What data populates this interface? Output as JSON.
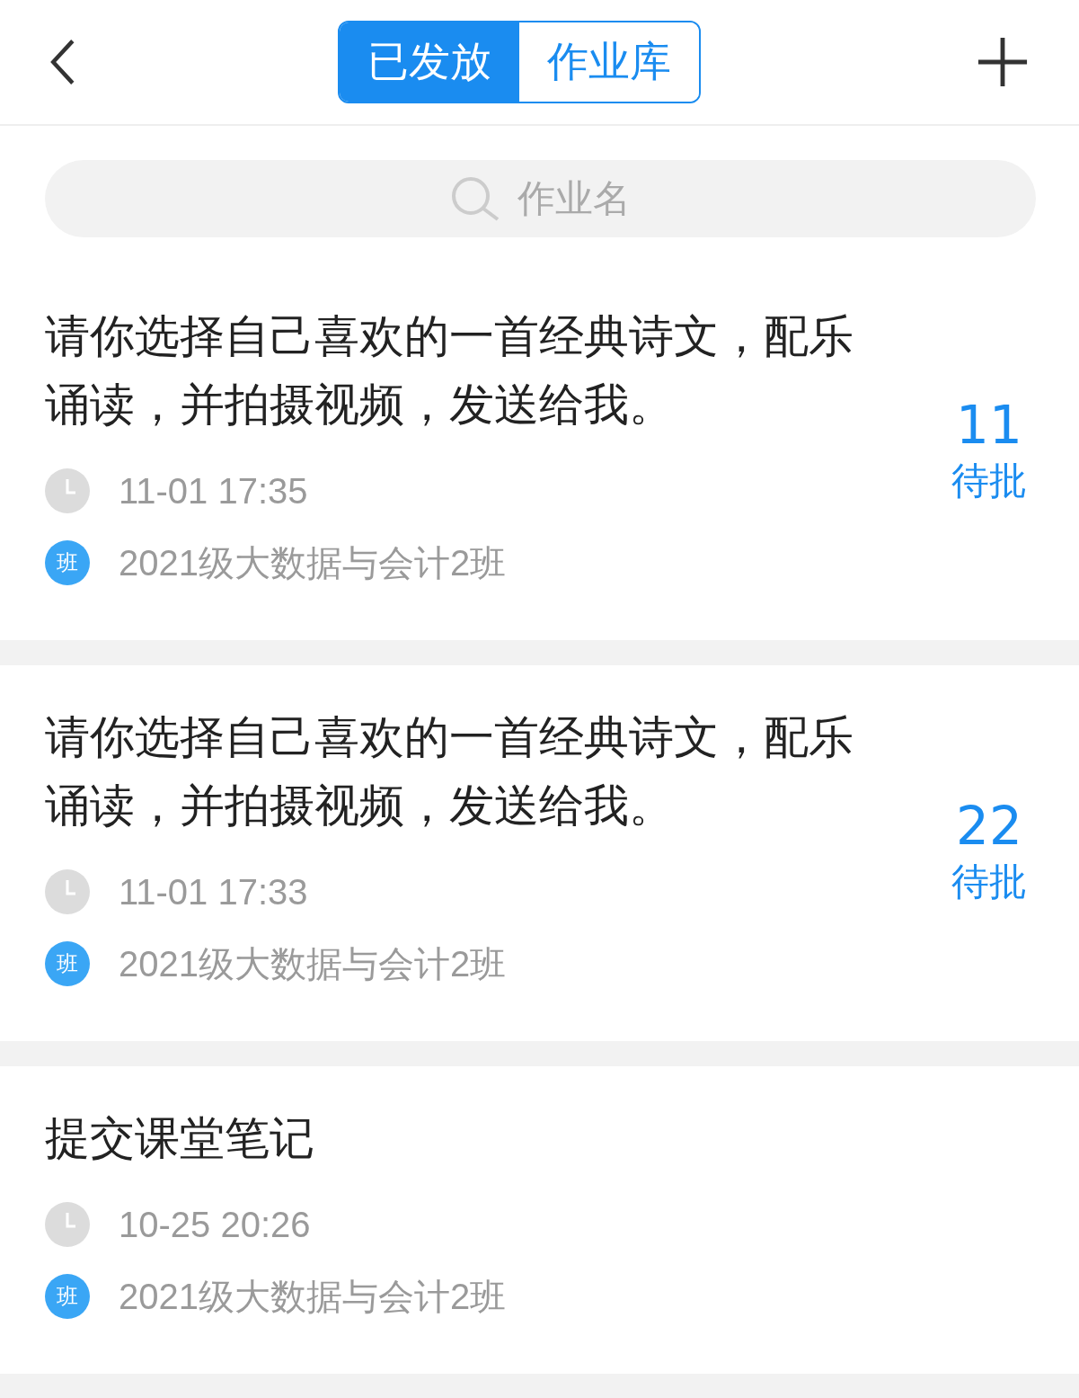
{
  "header": {
    "tabs": [
      {
        "label": "已发放",
        "selected": true
      },
      {
        "label": "作业库",
        "selected": false
      }
    ]
  },
  "search": {
    "placeholder": "作业名"
  },
  "assignments": [
    {
      "title": "请你选择自己喜欢的一首经典诗文，配乐诵读，并拍摄视频，发送给我。",
      "time": "11-01 17:35",
      "class_badge": "班",
      "class_name": "2021级大数据与会计2班",
      "pending_count": "11",
      "pending_label": "待批"
    },
    {
      "title": "请你选择自己喜欢的一首经典诗文，配乐诵读，并拍摄视频，发送给我。",
      "time": "11-01 17:33",
      "class_badge": "班",
      "class_name": "2021级大数据与会计2班",
      "pending_count": "22",
      "pending_label": "待批"
    },
    {
      "title": "提交课堂笔记",
      "time": "10-25 20:26",
      "class_badge": "班",
      "class_name": "2021级大数据与会计2班"
    }
  ]
}
